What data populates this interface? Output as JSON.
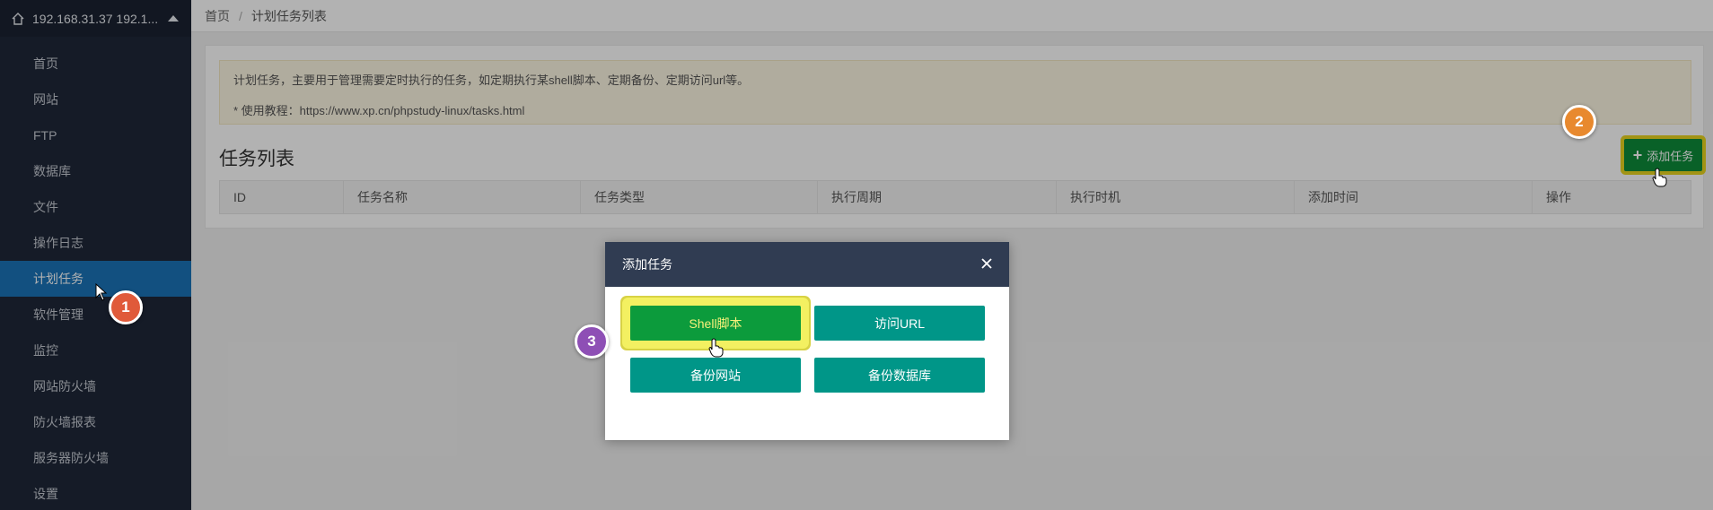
{
  "sidebar": {
    "host": "192.168.31.37 192.1...",
    "items": [
      {
        "label": "首页"
      },
      {
        "label": "网站"
      },
      {
        "label": "FTP"
      },
      {
        "label": "数据库"
      },
      {
        "label": "文件"
      },
      {
        "label": "操作日志"
      },
      {
        "label": "计划任务",
        "active": true
      },
      {
        "label": "软件管理"
      },
      {
        "label": "监控"
      },
      {
        "label": "网站防火墙"
      },
      {
        "label": "防火墙报表"
      },
      {
        "label": "服务器防火墙"
      },
      {
        "label": "设置"
      }
    ]
  },
  "breadcrumb": {
    "home": "首页",
    "separator": "/",
    "current": "计划任务列表"
  },
  "notice": {
    "line1": "计划任务，主要用于管理需要定时执行的任务，如定期执行某shell脚本、定期备份、定期访问url等。",
    "line2": "* 使用教程：https://www.xp.cn/phpstudy-linux/tasks.html"
  },
  "task_list": {
    "title": "任务列表",
    "add_button": "添加任务",
    "columns": [
      "ID",
      "任务名称",
      "任务类型",
      "执行周期",
      "执行时机",
      "添加时间",
      "操作"
    ]
  },
  "modal": {
    "title": "添加任务",
    "options": [
      "Shell脚本",
      "访问URL",
      "备份网站",
      "备份数据库"
    ]
  },
  "markers": [
    "1",
    "2",
    "3"
  ],
  "colors": {
    "sidebar_bg": "#1f2838",
    "active_item": "#1a73b8",
    "modal_header": "#303c52",
    "option_teal": "#009688",
    "option_green": "#0c9b3c",
    "highlight_yellow": "#f3f061",
    "marker1": "#e05a3a",
    "marker2": "#e8892e",
    "marker3": "#8e4fb5"
  }
}
